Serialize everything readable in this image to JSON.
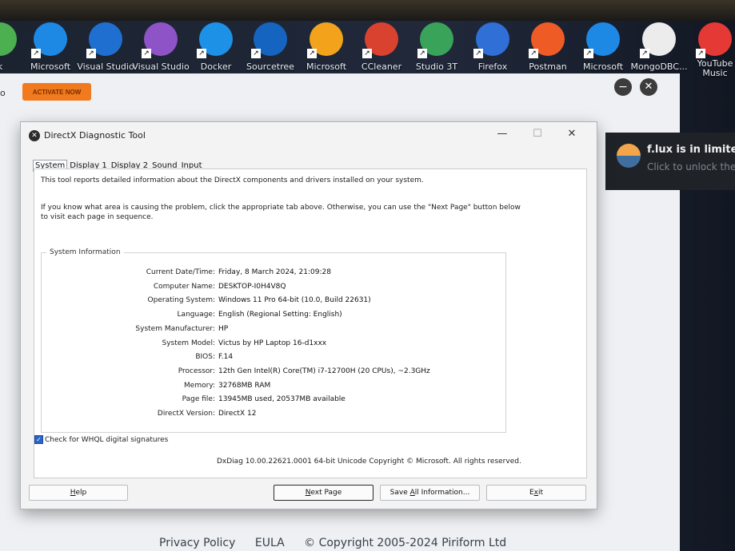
{
  "taskbar": {
    "apps": [
      {
        "label": "k",
        "icon": "partial-app-icon",
        "color": "#4caf50"
      },
      {
        "label": "Microsoft",
        "icon": "edge-icon",
        "color": "#1e88e5"
      },
      {
        "label": "Visual Studio",
        "icon": "vscode-icon",
        "color": "#1f6fd1"
      },
      {
        "label": "Visual Studio",
        "icon": "visual-studio-icon",
        "color": "#8e53c6"
      },
      {
        "label": "Docker",
        "icon": "docker-icon",
        "color": "#1d91e6"
      },
      {
        "label": "Sourcetree",
        "icon": "sourcetree-icon",
        "color": "#1565c0"
      },
      {
        "label": "Microsoft",
        "icon": "office-icon",
        "color": "#f2a31b"
      },
      {
        "label": "CCleaner",
        "icon": "ccleaner-icon",
        "color": "#d8422f"
      },
      {
        "label": "Studio 3T",
        "icon": "studio3t-icon",
        "color": "#3aa35a"
      },
      {
        "label": "Firefox",
        "icon": "firefox-icon",
        "color": "#2f6fd6"
      },
      {
        "label": "Postman",
        "icon": "postman-icon",
        "color": "#ef5b25"
      },
      {
        "label": "Microsoft",
        "icon": "edge-icon",
        "color": "#1e88e5"
      },
      {
        "label": "MongoDBC...",
        "icon": "mongodb-compass-icon",
        "color": "#ececec"
      },
      {
        "label": "YouTube Music",
        "icon": "youtube-music-icon",
        "color": "#e53935"
      }
    ]
  },
  "ccleaner": {
    "activate_label": "ACTIVATE NOW",
    "left_glyph": "o",
    "footer": {
      "privacy": "Privacy Policy",
      "eula": "EULA",
      "copyright": "© Copyright 2005-2024 Piriform Ltd"
    }
  },
  "flux": {
    "title": "f.lux is in limited c",
    "subtitle": "Click to unlock the f"
  },
  "dxdiag": {
    "title": "DirectX Diagnostic Tool",
    "window_buttons": {
      "minimize": "—",
      "maximize": "☐",
      "close": "✕"
    },
    "tabs": [
      "System",
      "Display 1",
      "Display 2",
      "Sound",
      "Input"
    ],
    "active_tab": "System",
    "intro_1": "This tool reports detailed information about the DirectX components and drivers installed on your system.",
    "intro_2": "If you know what area is causing the problem, click the appropriate tab above.  Otherwise, you can use the \"Next Page\" button below to visit each page in sequence.",
    "system_info_label": "System Information",
    "rows": [
      {
        "k": "Current Date/Time:",
        "v": "Friday, 8 March 2024, 21:09:28"
      },
      {
        "k": "Computer Name:",
        "v": "DESKTOP-I0H4V8Q"
      },
      {
        "k": "Operating System:",
        "v": "Windows 11 Pro 64-bit (10.0, Build 22631)"
      },
      {
        "k": "Language:",
        "v": "English (Regional Setting: English)"
      },
      {
        "k": "System Manufacturer:",
        "v": "HP"
      },
      {
        "k": "System Model:",
        "v": "Victus by HP Laptop 16-d1xxx"
      },
      {
        "k": "BIOS:",
        "v": "F.14"
      },
      {
        "k": "Processor:",
        "v": "12th Gen Intel(R) Core(TM) i7-12700H (20 CPUs), ~2.3GHz"
      },
      {
        "k": "Memory:",
        "v": "32768MB RAM"
      },
      {
        "k": "Page file:",
        "v": "13945MB used, 20537MB available"
      },
      {
        "k": "DirectX Version:",
        "v": "DirectX 12"
      }
    ],
    "whql_label": "Check for WHQL digital signatures",
    "whql_checked": true,
    "footer": "DxDiag 10.00.22621.0001 64-bit Unicode  Copyright © Microsoft. All rights reserved.",
    "buttons": {
      "help": "Help",
      "next_page": "Next Page",
      "save_all": "Save All Information...",
      "exit": "Exit"
    }
  }
}
